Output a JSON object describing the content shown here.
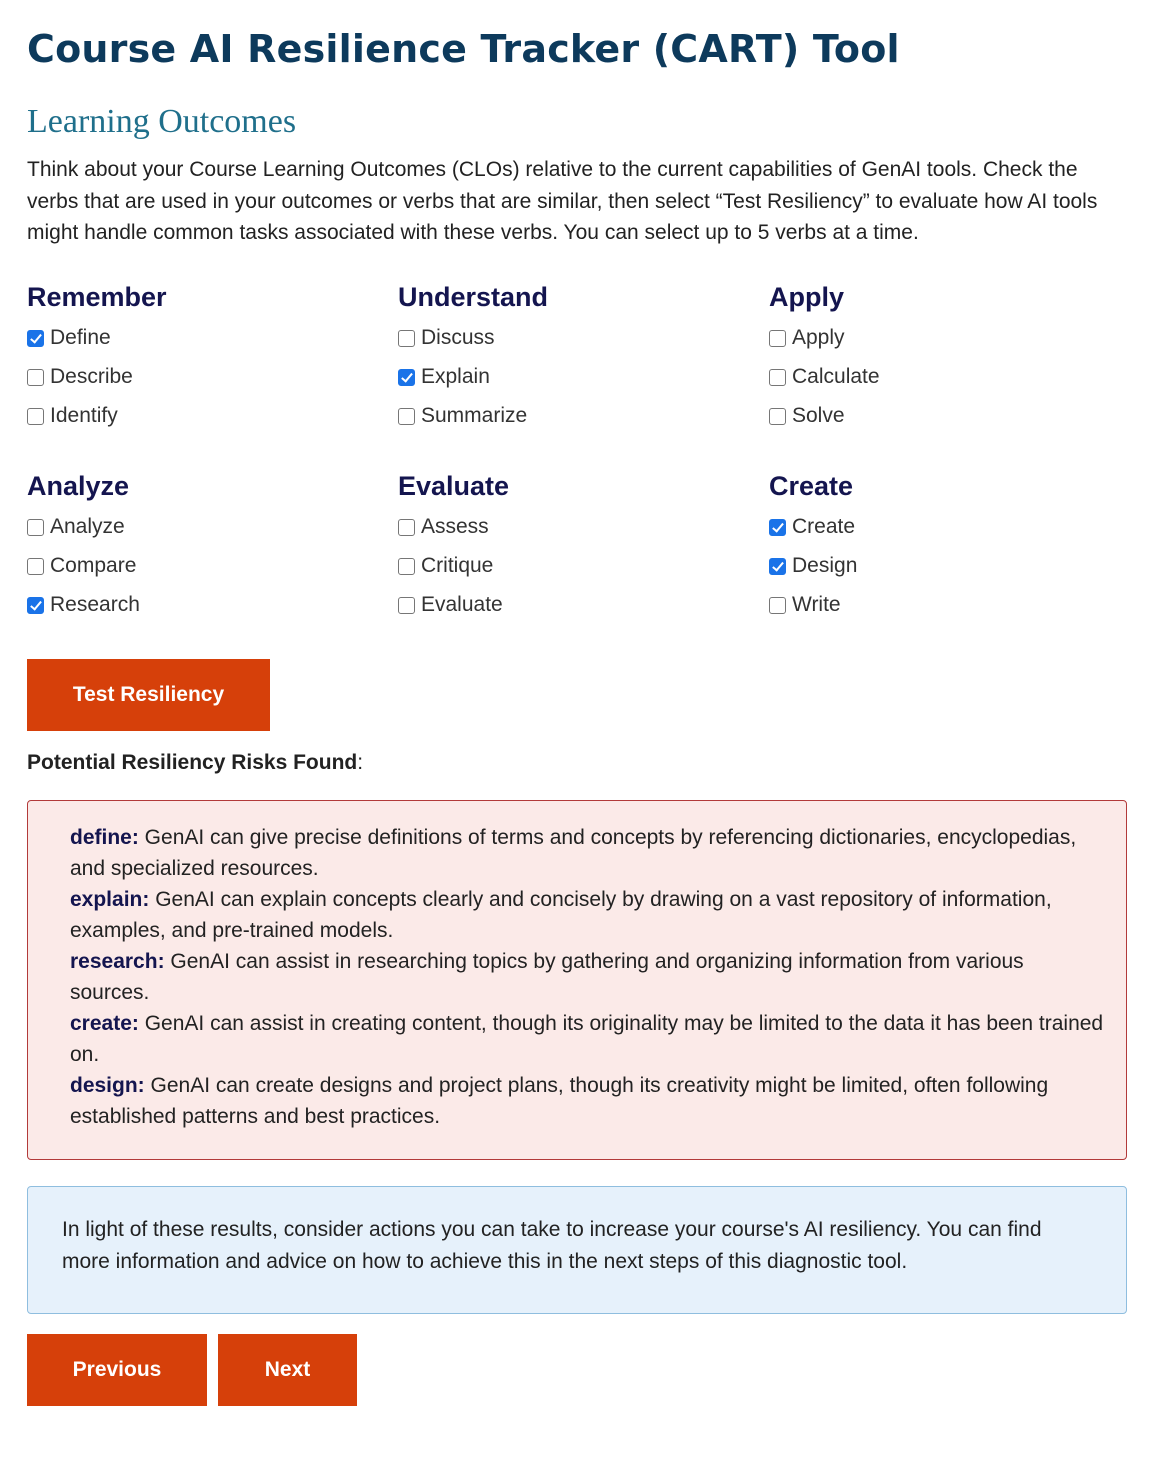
{
  "page": {
    "title": "Course AI Resilience Tracker (CART) Tool",
    "section_title": "Learning Outcomes",
    "intro": "Think about your Course Learning Outcomes (CLOs) relative to the current capabilities of GenAI tools. Check the verbs that are used in your outcomes or verbs that are similar, then select “Test Resiliency” to evaluate how AI tools might handle common tasks associated with these verbs. You can select up to 5 verbs at a time."
  },
  "verb_groups": [
    {
      "title": "Remember",
      "verbs": [
        {
          "label": "Define",
          "checked": true
        },
        {
          "label": "Describe",
          "checked": false
        },
        {
          "label": "Identify",
          "checked": false
        }
      ]
    },
    {
      "title": "Understand",
      "verbs": [
        {
          "label": "Discuss",
          "checked": false
        },
        {
          "label": "Explain",
          "checked": true
        },
        {
          "label": "Summarize",
          "checked": false
        }
      ]
    },
    {
      "title": "Apply",
      "verbs": [
        {
          "label": "Apply",
          "checked": false
        },
        {
          "label": "Calculate",
          "checked": false
        },
        {
          "label": "Solve",
          "checked": false
        }
      ]
    },
    {
      "title": "Analyze",
      "verbs": [
        {
          "label": "Analyze",
          "checked": false
        },
        {
          "label": "Compare",
          "checked": false
        },
        {
          "label": "Research",
          "checked": true
        }
      ]
    },
    {
      "title": "Evaluate",
      "verbs": [
        {
          "label": "Assess",
          "checked": false
        },
        {
          "label": "Critique",
          "checked": false
        },
        {
          "label": "Evaluate",
          "checked": false
        }
      ]
    },
    {
      "title": "Create",
      "verbs": [
        {
          "label": "Create",
          "checked": true
        },
        {
          "label": "Design",
          "checked": true
        },
        {
          "label": "Write",
          "checked": false
        }
      ]
    }
  ],
  "buttons": {
    "test_resiliency": "Test Resiliency",
    "previous": "Previous",
    "next": "Next"
  },
  "risks": {
    "label": "Potential Resiliency Risks Found",
    "label_suffix": ":",
    "items": [
      {
        "verb": "define:",
        "text": " GenAI can give precise definitions of terms and concepts by referencing dictionaries, encyclopedias, and specialized resources."
      },
      {
        "verb": "explain:",
        "text": " GenAI can explain concepts clearly and concisely by drawing on a vast repository of information, examples, and pre-trained models."
      },
      {
        "verb": "research:",
        "text": " GenAI can assist in researching topics by gathering and organizing information from various sources."
      },
      {
        "verb": "create:",
        "text": " GenAI can assist in creating content, though its originality may be limited to the data it has been trained on."
      },
      {
        "verb": "design:",
        "text": " GenAI can create designs and project plans, though its creativity might be limited, often following established patterns and best practices."
      }
    ]
  },
  "info": {
    "text": "In light of these results, consider actions you can take to increase your course's AI resiliency. You can find more information and advice on how to achieve this in the next steps of this diagnostic tool."
  },
  "colors": {
    "title": "#0d3a5c",
    "section_title": "#1f6f8b",
    "group_title": "#14154f",
    "button": "#d6400a",
    "risk_bg": "#fbeae8",
    "risk_border": "#b23a3a",
    "info_bg": "#e6f1fb",
    "info_border": "#8fbedf",
    "checkbox_checked": "#1a73e8"
  }
}
